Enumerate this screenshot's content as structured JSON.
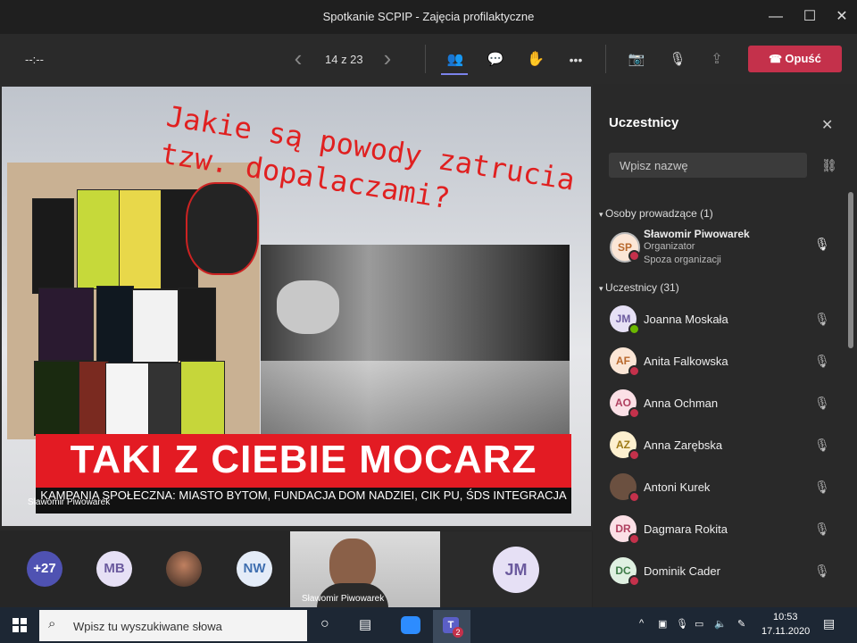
{
  "window": {
    "title": "Spotkanie SCPIP - Zajęcia profilaktyczne",
    "minimize": "—",
    "maximize": "☐",
    "close": "✕"
  },
  "toolbar": {
    "timer": "--:--",
    "slide_counter": "14 z 23",
    "prev_icon": "‹",
    "next_icon": "›",
    "people_icon": "👥",
    "chat_icon": "💬",
    "hand_icon": "✋",
    "more_icon": "•••",
    "camera_off_icon": "📷",
    "mic_off_icon": "🎙",
    "share_icon": "⇪",
    "leave_label": "Opuść",
    "leave_color": "#c4314b"
  },
  "slide": {
    "question": "Jakie są powody zatrucia tzw. dopalaczami?",
    "banner": "TAKI Z CIEBIE MOCARZ",
    "campaign": "KAMPANIA SPOŁECZNA: MIASTO BYTOM, FUNDACJA DOM NADZIEI, CIK PU, ŚDS INTEGRACJA",
    "presenter_label": "Sławomir Piwowarek"
  },
  "strip": {
    "more_count": "+27",
    "avatar_mb": "MB",
    "avatar_nw": "NW",
    "video_label": "Sławomir Piwowarek",
    "avatar_jm": "JM"
  },
  "panel": {
    "title": "Uczestnicy",
    "search_placeholder": "Wpisz nazwę",
    "presenters_header": "Osoby prowadzące (1)",
    "presenter": {
      "initials": "SP",
      "name": "Sławomir Piwowarek",
      "role": "Organizator",
      "org": "Spoza organizacji"
    },
    "attendees_header": "Uczestnicy (31)",
    "attendees": [
      {
        "initials": "JM",
        "name": "Joanna Moskała",
        "bg": "#e6e0f5",
        "fg": "#6b5a9e"
      },
      {
        "initials": "AF",
        "name": "Anita Falkowska",
        "bg": "#fbe6d6",
        "fg": "#b8682c"
      },
      {
        "initials": "AO",
        "name": "Anna Ochman",
        "bg": "#fbe0e6",
        "fg": "#b04060"
      },
      {
        "initials": "AZ",
        "name": "Anna Zarębska",
        "bg": "#fdf0cf",
        "fg": "#9e7a16"
      },
      {
        "initials": "",
        "name": "Antoni Kurek",
        "bg": "#6b5040",
        "fg": "#fff"
      },
      {
        "initials": "DR",
        "name": "Dagmara Rokita",
        "bg": "#fbe0e6",
        "fg": "#b04060"
      },
      {
        "initials": "DC",
        "name": "Dominik Cader",
        "bg": "#dff0e1",
        "fg": "#3c7a46"
      }
    ]
  },
  "taskbar": {
    "search_text": "Wpisz tu wyszukiwane słowa",
    "time": "10:53",
    "date": "17.11.2020",
    "teams_badge": "2"
  }
}
